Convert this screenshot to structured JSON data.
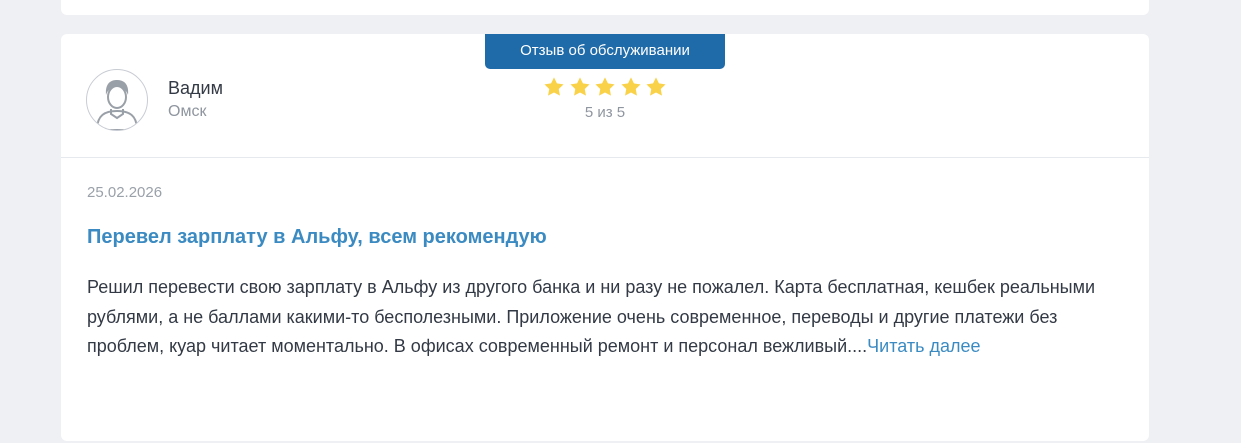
{
  "review": {
    "badge": "Отзыв об обслуживании",
    "author": {
      "name": "Вадим",
      "city": "Омск"
    },
    "rating": {
      "value": 5,
      "max": 5,
      "text": "5 из 5"
    },
    "date": "25.02.2026",
    "title": "Перевел зарплату в Альфу, всем рекомендую",
    "body": "Решил перевести свою зарплату в Альфу из другого банка и ни разу не пожалел. Карта бесплатная, кешбек реальными рублями, а не баллами какими-то бесполезными. Приложение очень современное, переводы и другие платежи без проблем, куар читает моментально. В офисах современный ремонт и персонал вежливый....",
    "read_more": "Читать далее"
  },
  "colors": {
    "badge_bg": "#1f6aa8",
    "star": "#f9d24a",
    "link": "#3b8bc2"
  },
  "icons": {
    "avatar": "user-avatar-icon",
    "star": "star-icon"
  }
}
